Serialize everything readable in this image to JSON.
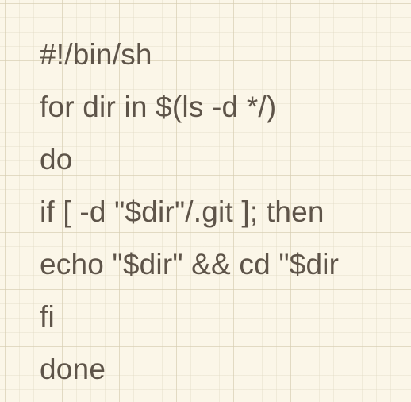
{
  "note": {
    "lines": [
      "#!/bin/sh",
      "for dir in $(ls -d */)",
      "do",
      "if [ -d \"$dir\"/.git ]; then",
      "echo \"$dir\" && cd \"$dir",
      "fi",
      "done"
    ]
  },
  "colors": {
    "background": "#fbf6e8",
    "grid": "#d6ccb0",
    "text": "#5e5449"
  }
}
